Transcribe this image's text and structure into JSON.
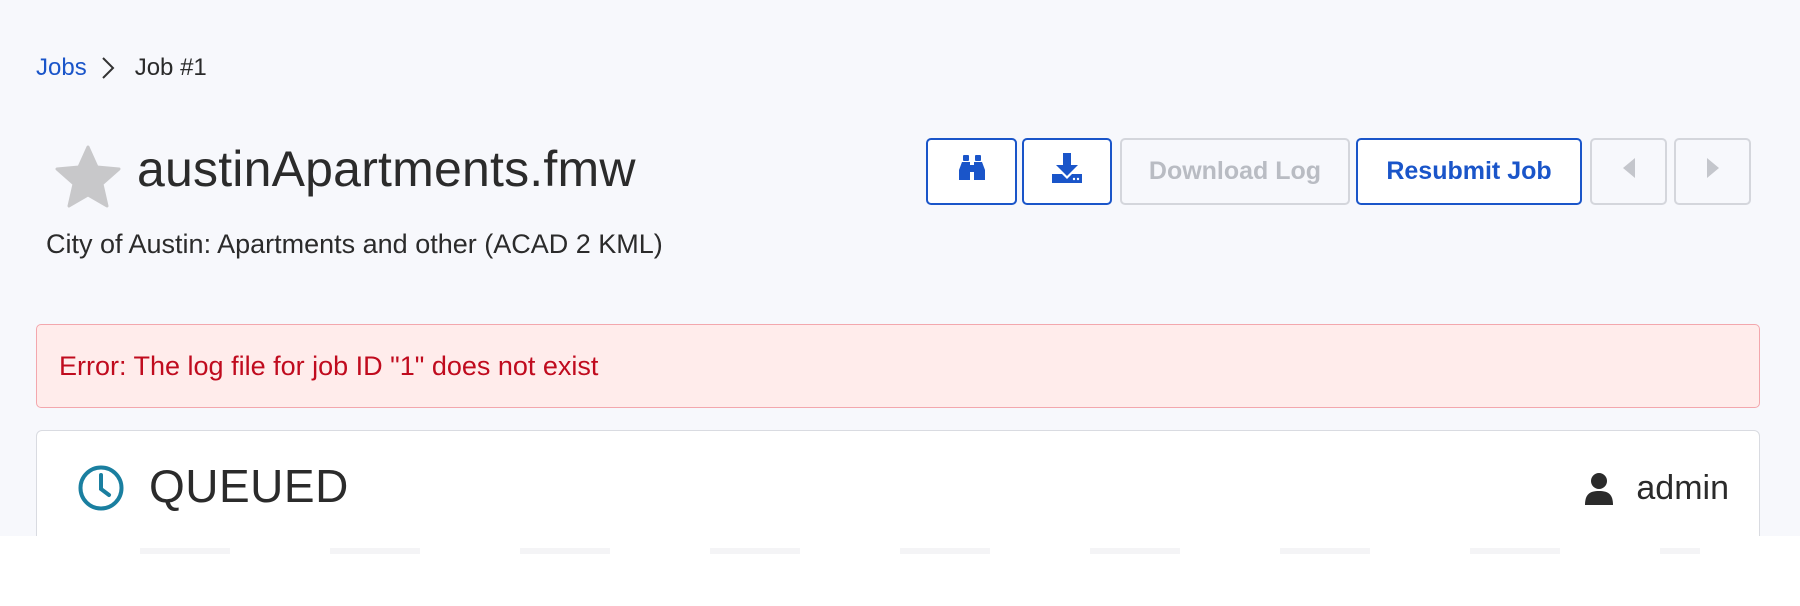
{
  "breadcrumb": {
    "root": "Jobs",
    "current": "Job #1"
  },
  "header": {
    "title": "austinApartments.fmw",
    "subtitle": "City of Austin: Apartments and other (ACAD 2 KML)",
    "favorite_icon": "star-icon"
  },
  "toolbar": {
    "view_icon": "binoculars-icon",
    "download_icon": "download-icon",
    "download_log_label": "Download Log",
    "resubmit_label": "Resubmit Job",
    "prev_icon": "caret-left-icon",
    "next_icon": "caret-right-icon"
  },
  "alert": {
    "message": "Error: The log file for job ID \"1\" does not exist"
  },
  "status_card": {
    "status": "QUEUED",
    "status_icon": "clock-icon",
    "user": "admin",
    "user_icon": "user-icon"
  },
  "colors": {
    "accent": "#1a55c9",
    "error_text": "#c00b1e",
    "error_bg": "#ffeceb",
    "status_icon": "#1a7fa0"
  }
}
